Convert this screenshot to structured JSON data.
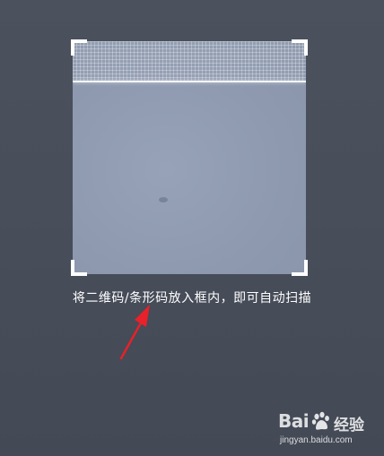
{
  "scanner": {
    "hint_text": "将二维码/条形码放入框内，即可自动扫描"
  },
  "annotation": {
    "arrow_color": "#e8212a"
  },
  "watermark": {
    "brand": "Bai",
    "brand_suffix": "经验",
    "url": "jingyan.baidu.com"
  },
  "colors": {
    "background": "#4a505c",
    "scan_area": "#8f9ab0",
    "frame_corners": "#ffffff",
    "scan_line": "#f2f5fa"
  }
}
